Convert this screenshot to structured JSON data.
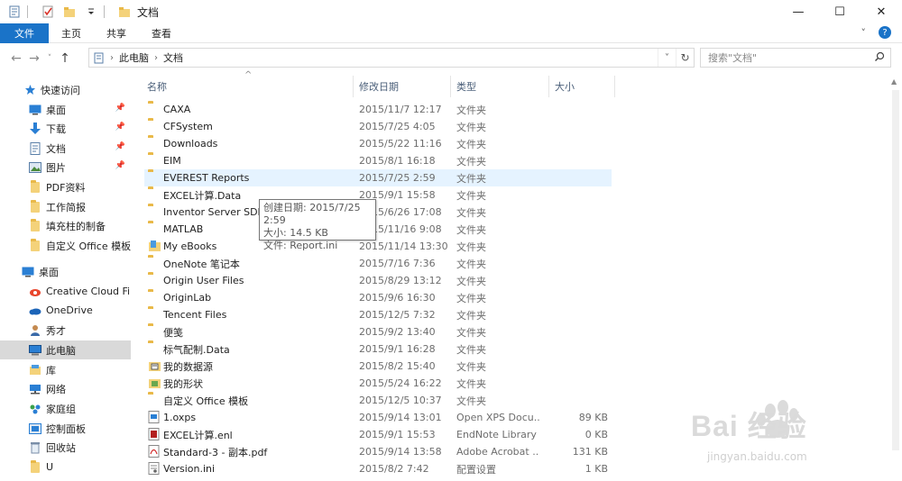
{
  "window": {
    "title": "文档",
    "controls": {
      "minimize": "—",
      "maximize": "☐",
      "close": "✕"
    }
  },
  "ribbon": {
    "tabs": [
      "文件",
      "主页",
      "共享",
      "查看"
    ],
    "collapse": "˅",
    "help": "?"
  },
  "address": {
    "segments": [
      "此电脑",
      "文档"
    ],
    "search_placeholder": "搜索\"文档\""
  },
  "sidebar": {
    "items": [
      {
        "label": "快速访问",
        "icon": "star-icon",
        "pinned": false
      },
      {
        "label": "桌面",
        "icon": "desktop-icon",
        "pinned": true
      },
      {
        "label": "下载",
        "icon": "download-icon",
        "pinned": true
      },
      {
        "label": "文档",
        "icon": "document-icon",
        "pinned": true
      },
      {
        "label": "图片",
        "icon": "picture-icon",
        "pinned": true
      },
      {
        "label": "PDF资料",
        "icon": "folder-icon",
        "pinned": false
      },
      {
        "label": "工作简报",
        "icon": "folder-icon",
        "pinned": false
      },
      {
        "label": "填充柱的制备",
        "icon": "folder-icon",
        "pinned": false
      },
      {
        "label": "自定义 Office 模板",
        "icon": "folder-icon",
        "pinned": false
      },
      {
        "label": "桌面",
        "icon": "desktop-icon",
        "pinned": false
      },
      {
        "label": "Creative Cloud Files",
        "icon": "creative-cloud-icon",
        "pinned": false
      },
      {
        "label": "OneDrive",
        "icon": "cloud-icon",
        "pinned": false
      },
      {
        "label": "秀才",
        "icon": "user-icon",
        "pinned": false
      },
      {
        "label": "此电脑",
        "icon": "computer-icon",
        "pinned": false
      },
      {
        "label": "库",
        "icon": "library-icon",
        "pinned": false
      },
      {
        "label": "网络",
        "icon": "network-icon",
        "pinned": false
      },
      {
        "label": "家庭组",
        "icon": "homegroup-icon",
        "pinned": false
      },
      {
        "label": "控制面板",
        "icon": "control-panel-icon",
        "pinned": false
      },
      {
        "label": "回收站",
        "icon": "recycle-bin-icon",
        "pinned": false
      },
      {
        "label": "U",
        "icon": "folder-icon",
        "pinned": false
      }
    ]
  },
  "columns": {
    "name": "名称",
    "date": "修改日期",
    "type": "类型",
    "size": "大小"
  },
  "files": [
    {
      "name": "CAXA",
      "date": "2015/11/7 12:17",
      "type": "文件夹",
      "size": "",
      "icon": "folder"
    },
    {
      "name": "CFSystem",
      "date": "2015/7/25 4:05",
      "type": "文件夹",
      "size": "",
      "icon": "folder"
    },
    {
      "name": "Downloads",
      "date": "2015/5/22 11:16",
      "type": "文件夹",
      "size": "",
      "icon": "folder"
    },
    {
      "name": "EIM",
      "date": "2015/8/1 16:18",
      "type": "文件夹",
      "size": "",
      "icon": "folder"
    },
    {
      "name": "EVEREST Reports",
      "date": "2015/7/25 2:59",
      "type": "文件夹",
      "size": "",
      "icon": "folder"
    },
    {
      "name": "EXCEL计算.Data",
      "date": "2015/9/1 15:58",
      "type": "文件夹",
      "size": "",
      "icon": "folder"
    },
    {
      "name": "Inventor Server SDK",
      "date": "2015/6/26 17:08",
      "type": "文件夹",
      "size": "",
      "icon": "folder"
    },
    {
      "name": "MATLAB",
      "date": "2015/11/16 9:08",
      "type": "文件夹",
      "size": "",
      "icon": "folder"
    },
    {
      "name": "My eBooks",
      "date": "2015/11/14 13:30",
      "type": "文件夹",
      "size": "",
      "icon": "ebooks"
    },
    {
      "name": "OneNote 笔记本",
      "date": "2015/7/16 7:36",
      "type": "文件夹",
      "size": "",
      "icon": "folder"
    },
    {
      "name": "Origin User Files",
      "date": "2015/8/29 13:12",
      "type": "文件夹",
      "size": "",
      "icon": "folder"
    },
    {
      "name": "OriginLab",
      "date": "2015/9/6 16:30",
      "type": "文件夹",
      "size": "",
      "icon": "folder"
    },
    {
      "name": "Tencent Files",
      "date": "2015/12/5 7:32",
      "type": "文件夹",
      "size": "",
      "icon": "folder"
    },
    {
      "name": "便笺",
      "date": "2015/9/2 13:40",
      "type": "文件夹",
      "size": "",
      "icon": "folder"
    },
    {
      "name": "标气配制.Data",
      "date": "2015/9/1 16:28",
      "type": "文件夹",
      "size": "",
      "icon": "folder"
    },
    {
      "name": "我的数据源",
      "date": "2015/8/2 15:40",
      "type": "文件夹",
      "size": "",
      "icon": "datasource"
    },
    {
      "name": "我的形状",
      "date": "2015/5/24 16:22",
      "type": "文件夹",
      "size": "",
      "icon": "shapes"
    },
    {
      "name": "自定义 Office 模板",
      "date": "2015/12/5 10:37",
      "type": "文件夹",
      "size": "",
      "icon": "folder"
    },
    {
      "name": "1.oxps",
      "date": "2015/9/14 13:01",
      "type": "Open XPS Docu...",
      "size": "89 KB",
      "icon": "oxps"
    },
    {
      "name": "EXCEL计算.enl",
      "date": "2015/9/1 15:53",
      "type": "EndNote Library",
      "size": "0 KB",
      "icon": "endnote"
    },
    {
      "name": "Standard-3 - 副本.pdf",
      "date": "2015/9/14 13:58",
      "type": "Adobe Acrobat ...",
      "size": "131 KB",
      "icon": "pdf"
    },
    {
      "name": "Version.ini",
      "date": "2015/8/2 7:42",
      "type": "配置设置",
      "size": "1 KB",
      "icon": "ini"
    }
  ],
  "tooltip": {
    "line1": "创建日期: 2015/7/25 2:59",
    "line2": "大小: 14.5 KB",
    "line3": "文件: Report.ini"
  },
  "watermark": {
    "main": "Bai 经验",
    "sub": "jingyan.baidu.com"
  }
}
